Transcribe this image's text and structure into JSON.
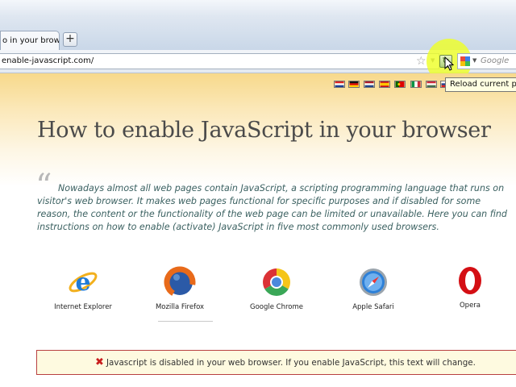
{
  "browser": {
    "tab_title": "o in your browse...",
    "new_tab_label": "+",
    "url": "enable-javascript.com/",
    "search_placeholder": "Google",
    "tooltip": "Reload current page"
  },
  "page": {
    "title": "How to enable JavaScript in your browser",
    "intro_lines": [
      "Nowadays almost all web pages contain JavaScript, a scripting programming language that runs on",
      "visitor's web browser. It makes web pages functional for specific purposes and if disabled for some",
      "reason, the content or the functionality of the web page can be limited or unavailable. Here you can find",
      "instructions on how to enable (activate) JavaScript in five most commonly used browsers."
    ],
    "browsers": [
      {
        "name": "Internet Explorer",
        "icon": "internet-explorer-icon"
      },
      {
        "name": "Mozilla Firefox",
        "icon": "firefox-icon"
      },
      {
        "name": "Google Chrome",
        "icon": "chrome-icon"
      },
      {
        "name": "Apple Safari",
        "icon": "safari-icon"
      },
      {
        "name": "Opera",
        "icon": "opera-icon"
      }
    ],
    "alert_text": "Javascript is disabled in your web browser. If you enable JavaScript, this text will change.",
    "languages": [
      "Croatian",
      "German",
      "Dutch",
      "Spanish",
      "Portuguese",
      "Italian",
      "Hungarian",
      "Slovenian"
    ]
  },
  "colors": {
    "highlight": "#eeff28",
    "alert_border": "#b84040",
    "alert_icon": "#c91e1e",
    "intro_text": "#3a6060"
  }
}
